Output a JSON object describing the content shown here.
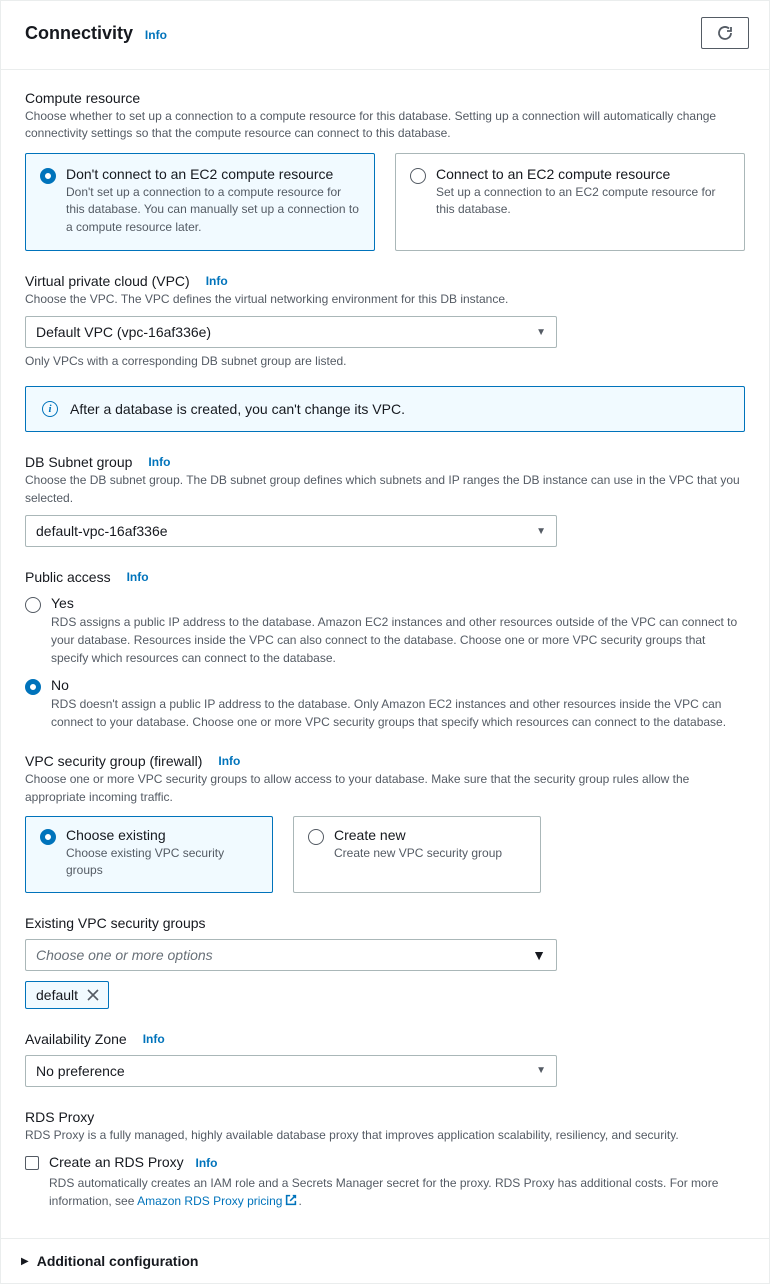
{
  "header": {
    "title": "Connectivity",
    "info": "Info"
  },
  "compute": {
    "label": "Compute resource",
    "desc": "Choose whether to set up a connection to a compute resource for this database. Setting up a connection will automatically change connectivity settings so that the compute resource can connect to this database.",
    "opt1": {
      "title": "Don't connect to an EC2 compute resource",
      "desc": "Don't set up a connection to a compute resource for this database. You can manually set up a connection to a compute resource later."
    },
    "opt2": {
      "title": "Connect to an EC2 compute resource",
      "desc": "Set up a connection to an EC2 compute resource for this database."
    }
  },
  "vpc": {
    "label": "Virtual private cloud (VPC)",
    "info": "Info",
    "desc": "Choose the VPC. The VPC defines the virtual networking environment for this DB instance.",
    "value": "Default VPC (vpc-16af336e)",
    "hint": "Only VPCs with a corresponding DB subnet group are listed.",
    "alert": "After a database is created, you can't change its VPC."
  },
  "subnet": {
    "label": "DB Subnet group",
    "info": "Info",
    "desc": "Choose the DB subnet group. The DB subnet group defines which subnets and IP ranges the DB instance can use in the VPC that you selected.",
    "value": "default-vpc-16af336e"
  },
  "public": {
    "label": "Public access",
    "info": "Info",
    "yes": {
      "title": "Yes",
      "desc": "RDS assigns a public IP address to the database. Amazon EC2 instances and other resources outside of the VPC can connect to your database. Resources inside the VPC can also connect to the database. Choose one or more VPC security groups that specify which resources can connect to the database."
    },
    "no": {
      "title": "No",
      "desc": "RDS doesn't assign a public IP address to the database. Only Amazon EC2 instances and other resources inside the VPC can connect to your database. Choose one or more VPC security groups that specify which resources can connect to the database."
    }
  },
  "sg": {
    "label": "VPC security group (firewall)",
    "info": "Info",
    "desc": "Choose one or more VPC security groups to allow access to your database. Make sure that the security group rules allow the appropriate incoming traffic.",
    "opt1": {
      "title": "Choose existing",
      "desc": "Choose existing VPC security groups"
    },
    "opt2": {
      "title": "Create new",
      "desc": "Create new VPC security group"
    }
  },
  "existing_sg": {
    "label": "Existing VPC security groups",
    "placeholder": "Choose one or more options",
    "token": "default"
  },
  "az": {
    "label": "Availability Zone",
    "info": "Info",
    "value": "No preference"
  },
  "proxy": {
    "label": "RDS Proxy",
    "desc": "RDS Proxy is a fully managed, highly available database proxy that improves application scalability, resiliency, and security.",
    "check_label": "Create an RDS Proxy",
    "info": "Info",
    "check_desc_pre": "RDS automatically creates an IAM role and a Secrets Manager secret for the proxy. RDS Proxy has additional costs. For more information, see ",
    "check_link": "Amazon RDS Proxy pricing",
    "check_desc_post": "."
  },
  "footer": {
    "label": "Additional configuration"
  }
}
